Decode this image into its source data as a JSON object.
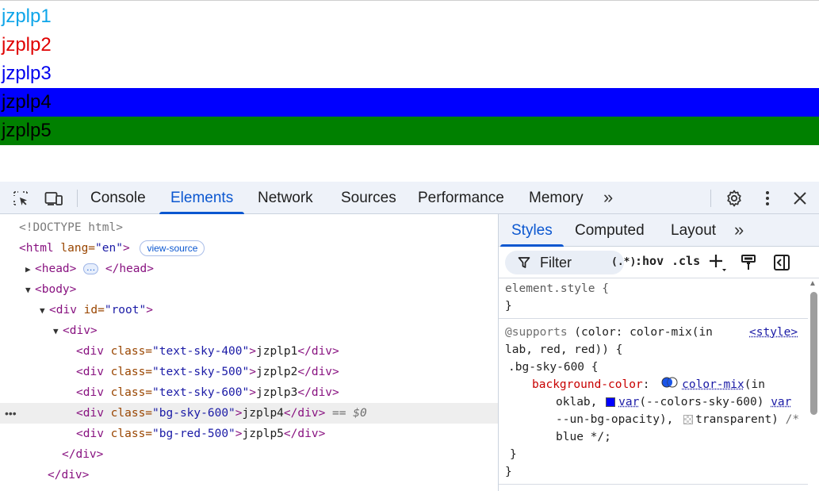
{
  "preview": {
    "rows": [
      {
        "text": "jzplp1",
        "color": "#0ea5e9",
        "bg": "transparent"
      },
      {
        "text": "jzplp2",
        "color": "#e00000",
        "bg": "transparent"
      },
      {
        "text": "jzplp3",
        "color": "#0000ee",
        "bg": "transparent"
      },
      {
        "text": "jzplp4",
        "color": "#000000",
        "bg": "#0000ff"
      },
      {
        "text": "jzplp5",
        "color": "#000000",
        "bg": "#008000"
      }
    ]
  },
  "devtools": {
    "tabs": {
      "console": "Console",
      "elements": "Elements",
      "network": "Network",
      "sources": "Sources",
      "performance": "Performance",
      "memory": "Memory",
      "more": "»"
    },
    "icons": {
      "inspect": "inspect-element-icon",
      "device": "device-toolbar-icon",
      "settings": "gear-icon",
      "menu": "kebab-menu-icon",
      "close": "close-icon"
    }
  },
  "elements": {
    "doctype": "<!DOCTYPE html>",
    "html_open_tag": "<html",
    "html_lang_attr": " lang=",
    "html_lang_val": "\"en\"",
    "html_close_bracket": ">",
    "view_source": "view-source",
    "head_open": "<head>",
    "head_ellipsis": "…",
    "head_close": "</head>",
    "body_open": "<body>",
    "root_div_open": "<div",
    "root_id_attr": " id=",
    "root_id_val": "\"root\"",
    "root_div_close_bracket": ">",
    "inner_div_open": "<div>",
    "children": [
      {
        "open": "<div",
        "attr": " class=",
        "val": "\"text-sky-400\"",
        "gt": ">",
        "text": "jzplp1",
        "close": "</div>",
        "suffix": ""
      },
      {
        "open": "<div",
        "attr": " class=",
        "val": "\"text-sky-500\"",
        "gt": ">",
        "text": "jzplp2",
        "close": "</div>",
        "suffix": ""
      },
      {
        "open": "<div",
        "attr": " class=",
        "val": "\"text-sky-600\"",
        "gt": ">",
        "text": "jzplp3",
        "close": "</div>",
        "suffix": ""
      },
      {
        "open": "<div",
        "attr": " class=",
        "val": "\"bg-sky-600\"",
        "gt": ">",
        "text": "jzplp4",
        "close": "</div>",
        "suffix": " == $0"
      },
      {
        "open": "<div",
        "attr": " class=",
        "val": "\"bg-red-500\"",
        "gt": ">",
        "text": "jzplp5",
        "close": "</div>",
        "suffix": ""
      }
    ],
    "inner_div_close": "</div>",
    "root_div_close": "</div>",
    "row_dots": "•••"
  },
  "styles": {
    "tabs": {
      "styles": "Styles",
      "computed": "Computed",
      "layout": "Layout",
      "more": "»"
    },
    "filter_label": "Filter",
    "regex_label": "(.*)",
    "hov_label": ":hov",
    "cls_label": ".cls",
    "add_label": "+",
    "element_style_selector": "element.style {",
    "element_style_close": "}",
    "supports_at": "@supports",
    "supports_cond_1": " (color: color-mix(in",
    "supports_cond_2": "lab, red, red)) {",
    "supports_source": "<style>",
    "rule_selector": ".bg-sky-600 {",
    "prop_name": "background-color",
    "prop_colon": ":",
    "fn_name": "color-mix",
    "fn_open": "(in",
    "line3_oklab": "oklab,",
    "line3_var": "var",
    "line3_arg": "(--colors-sky-600)",
    "line3_var2": "var",
    "line4_arg": "--un-bg-opacity),",
    "line4_transparent": "transparent)",
    "line4_comment": "/*",
    "line5_comment": "blue */;",
    "rule_close": "}",
    "supports_close": "}",
    "swatch_color": "#0000ff"
  }
}
